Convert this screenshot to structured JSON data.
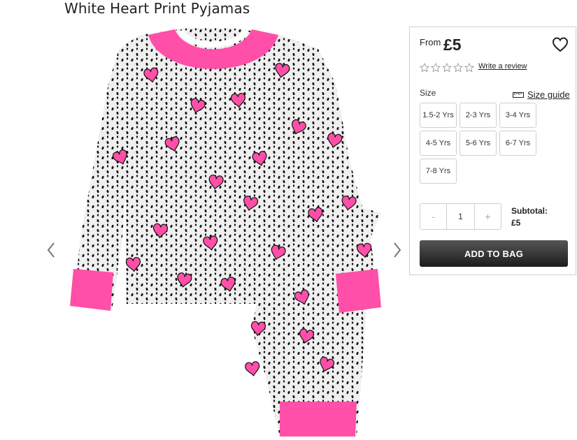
{
  "product": {
    "title": "White Heart Print Pyjamas",
    "image_alt": "White heart print pyjamas set"
  },
  "gallery": {
    "prev_icon": "chevron-left-icon",
    "next_icon": "chevron-right-icon"
  },
  "purchase": {
    "from_label": "From",
    "price": "£5",
    "wishlist_icon": "heart-outline-icon",
    "rating_stars": 0,
    "review_link": "Write a review",
    "size_label": "Size",
    "size_guide_label": "Size guide",
    "sizes": [
      "1.5-2 Yrs",
      "2-3 Yrs",
      "3-4 Yrs",
      "4-5 Yrs",
      "5-6 Yrs",
      "6-7 Yrs",
      "7-8 Yrs"
    ],
    "quantity": {
      "minus": "-",
      "value": "1",
      "plus": "+"
    },
    "subtotal_label": "Subtotal:",
    "subtotal_value": "£5",
    "add_to_bag": "ADD TO BAG"
  },
  "colors": {
    "accent_pink": "#ff4fa8",
    "button_dark": "#1d1d1d"
  }
}
